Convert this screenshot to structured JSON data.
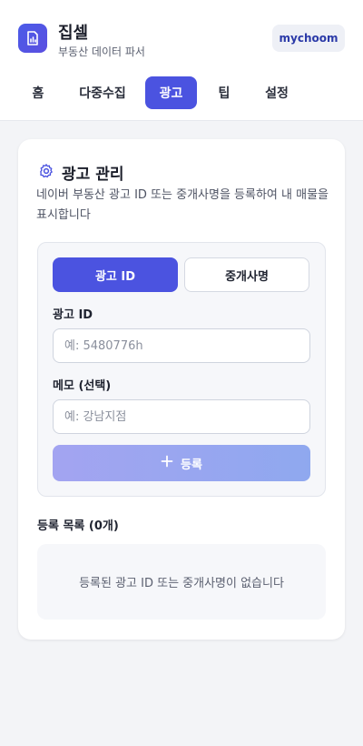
{
  "app": {
    "title": "집셀",
    "subtitle": "부동산 데이터 파서",
    "user": "mychoom"
  },
  "tabs": [
    {
      "label": "홈"
    },
    {
      "label": "다중수집"
    },
    {
      "label": "광고",
      "active": true
    },
    {
      "label": "팁"
    },
    {
      "label": "설정"
    }
  ],
  "ads": {
    "title": "광고 관리",
    "description": "네이버 부동산 광고 ID 또는 중개사명을 등록하여 내 매물을 표시합니다",
    "mode_buttons": {
      "ad_id": "광고 ID",
      "agent_name": "중개사명"
    },
    "fields": {
      "ad_id_label": "광고 ID",
      "ad_id_placeholder": "예: 5480776h",
      "memo_label": "메모 (선택)",
      "memo_placeholder": "예: 강남지점"
    },
    "submit_label": "등록",
    "list_title": "등록 목록 (0개)",
    "empty_message": "등록된 광고 ID 또는 중개사명이 없습니다"
  },
  "colors": {
    "accent": "#4b53e0",
    "background": "#f3f4f7"
  },
  "icons": {
    "logo": "document-chart-icon",
    "card_head": "gear-icon",
    "submit": "plus-icon"
  }
}
